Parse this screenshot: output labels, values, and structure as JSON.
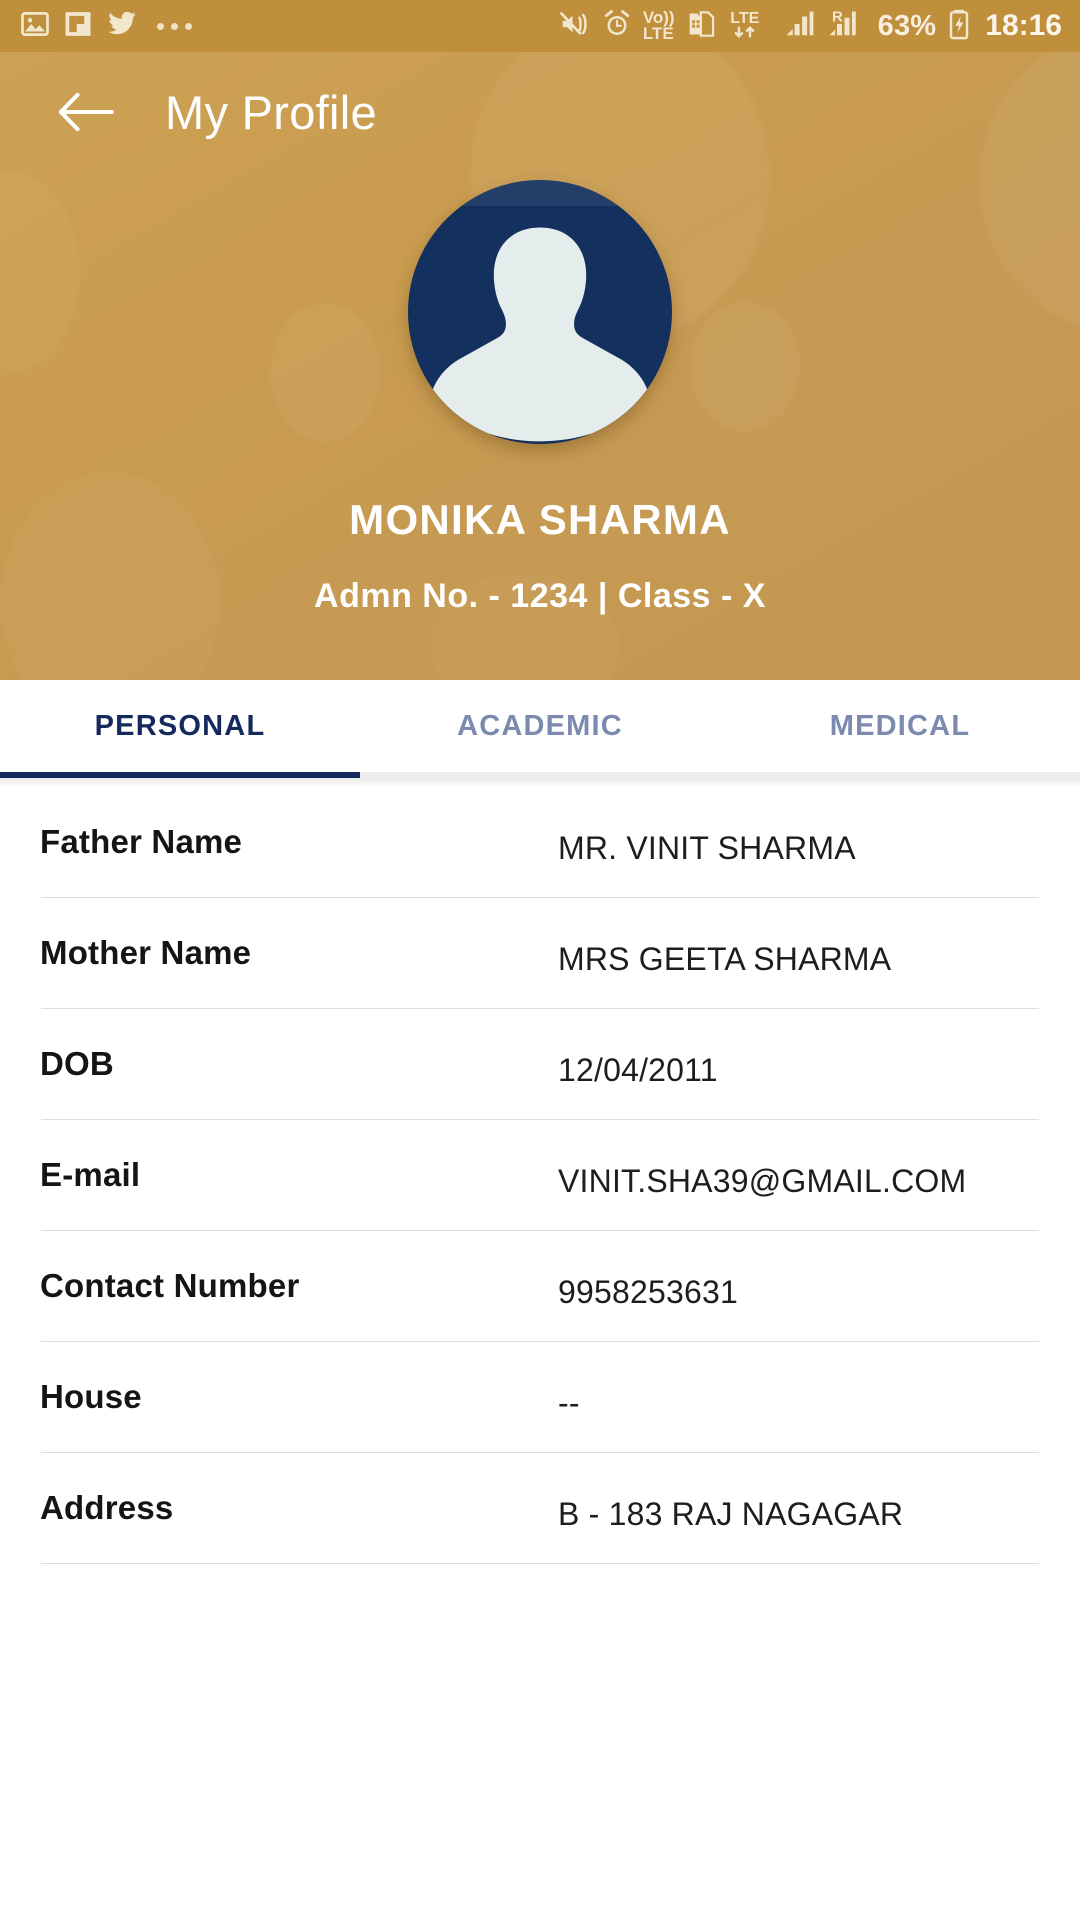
{
  "status_bar": {
    "left_icons": [
      "image-icon",
      "flipboard-icon",
      "twitter-icon",
      "more-dots-icon"
    ],
    "right_icons": [
      "mute-vibrate-icon",
      "alarm-icon",
      "volte-icon",
      "sim-card-icon",
      "lte-data-icon",
      "signal-bars-icon",
      "roaming-signal-icon"
    ],
    "volte_top": "Vo))",
    "volte_bottom": "LTE",
    "lte_label": "LTE",
    "roaming_label": "R",
    "battery": "63%",
    "time": "18:16"
  },
  "appbar": {
    "back_icon": "arrow-left-icon",
    "title": "My Profile"
  },
  "profile": {
    "avatar_icon": "person-placeholder-icon",
    "name": "MONIKA SHARMA",
    "subtitle": "Admn No. - 1234  |  Class - X",
    "admission_no": "1234",
    "class": "X"
  },
  "tabs": [
    {
      "label": "PERSONAL",
      "active": true
    },
    {
      "label": "ACADEMIC",
      "active": false
    },
    {
      "label": "MEDICAL",
      "active": false
    }
  ],
  "details": [
    {
      "label": "Father Name",
      "value": "MR. VINIT SHARMA"
    },
    {
      "label": "Mother Name",
      "value": "MRS GEETA SHARMA"
    },
    {
      "label": "DOB",
      "value": "12/04/2011"
    },
    {
      "label": "E-mail",
      "value": "VINIT.SHA39@GMAIL.COM"
    },
    {
      "label": "Contact Number",
      "value": "9958253631"
    },
    {
      "label": "House",
      "value": "--"
    },
    {
      "label": "Address",
      "value": "B - 183 RAJ NAGAGAR"
    }
  ],
  "colors": {
    "status_bar": "#bf8f3c",
    "header_gold": "#c99c4f",
    "accent_navy": "#16295c",
    "avatar_navy": "#14305f",
    "avatar_silhouette": "#e4ecec",
    "tab_inactive": "#7c8ab0",
    "divider": "#dcdcdc"
  }
}
